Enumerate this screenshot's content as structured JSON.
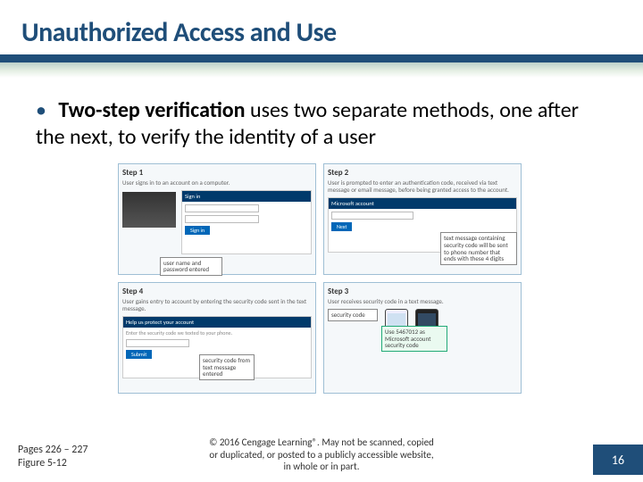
{
  "title": "Unauthorized Access and Use",
  "bullet": {
    "term": "Two-step verification",
    "rest": " uses two separate methods, one after the next, to verify the identity of a user"
  },
  "figure": {
    "steps": [
      {
        "num": "Step 1",
        "desc": "User signs in to an account on a computer.",
        "panel_head": "Sign in",
        "callout": "user name and password entered"
      },
      {
        "num": "Step 2",
        "desc": "User is prompted to enter an authentication code, received via text message or email message, before being granted access to the account.",
        "panel_head": "Microsoft account",
        "callout": "text message containing security code will be sent to phone number that ends with these 4 digits"
      },
      {
        "num": "Step 3",
        "desc": "User receives security code in a text message.",
        "callout_a": "security code",
        "callout_b": "Use 5467012 as Microsoft account security code"
      },
      {
        "num": "Step 4",
        "desc": "User gains entry to account by entering the security code sent in the text message.",
        "panel_head": "Help us protect your account",
        "callout": "security code from text message entered"
      }
    ]
  },
  "footer": {
    "pages": "Pages 226 – 227",
    "figref": "Figure 5-12",
    "copyright_l1": "© 2016 Cengage Learning®. May not be scanned, copied",
    "copyright_l2": "or duplicated, or posted to a publicly accessible website,",
    "copyright_l3": "in whole or in part.",
    "slide_number": "16"
  }
}
